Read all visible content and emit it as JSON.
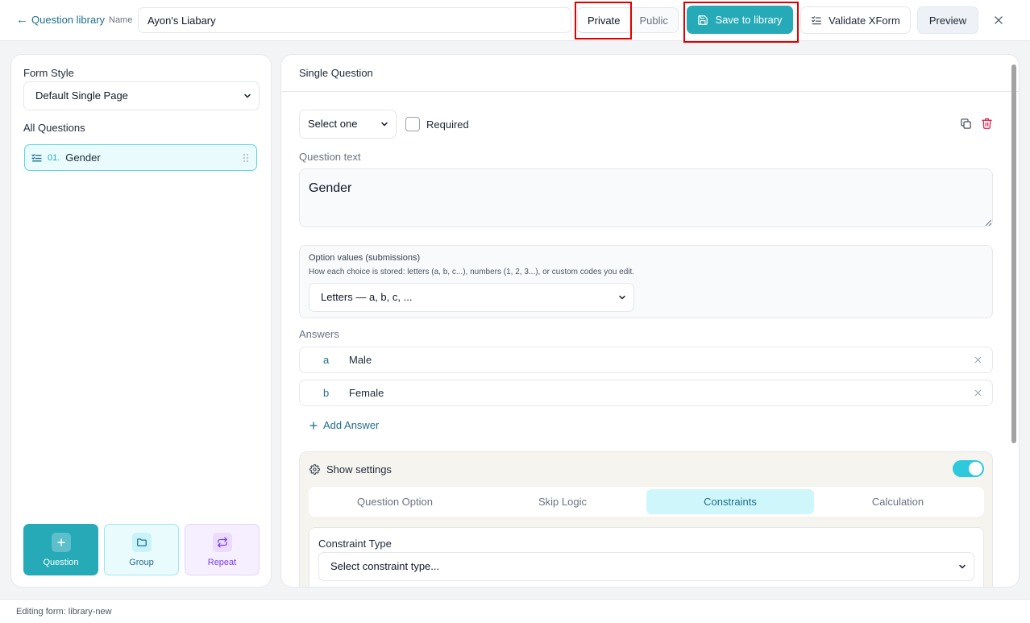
{
  "header": {
    "back_label": "Question library",
    "name_label": "Name",
    "name_value": "Ayon's Liabary",
    "visibility": {
      "private": "Private",
      "public": "Public",
      "selected": "Private"
    },
    "save_label": "Save to library",
    "validate_label": "Validate XForm",
    "preview_label": "Preview"
  },
  "sidebar": {
    "form_style_label": "Form Style",
    "form_style_value": "Default Single Page",
    "all_questions_label": "All Questions",
    "questions": [
      {
        "number": "01.",
        "title": "Gender"
      }
    ],
    "tools": {
      "question": "Question",
      "group": "Group",
      "repeat": "Repeat"
    }
  },
  "editor": {
    "panel_title": "Single Question",
    "type_value": "Select one",
    "required_label": "Required",
    "required_checked": false,
    "question_text_label": "Question text",
    "question_text_value": "Gender",
    "option_values": {
      "title": "Option values (submissions)",
      "description": "How each choice is stored: letters (a, b, c...), numbers (1, 2, 3...), or custom codes you edit.",
      "selected": "Letters — a, b, c, ..."
    },
    "answers_label": "Answers",
    "answers": [
      {
        "key": "a",
        "label": "Male"
      },
      {
        "key": "b",
        "label": "Female"
      }
    ],
    "add_answer_label": "Add Answer",
    "settings": {
      "title": "Show settings",
      "enabled": true,
      "tabs": [
        {
          "label": "Question Option",
          "active": false
        },
        {
          "label": "Skip Logic",
          "active": false
        },
        {
          "label": "Constraints",
          "active": true
        },
        {
          "label": "Calculation",
          "active": false
        }
      ],
      "constraint_type_label": "Constraint Type",
      "constraint_type_placeholder": "Select constraint type..."
    }
  },
  "status": {
    "text": "Editing form: library-new"
  },
  "colors": {
    "accent": "#26aab7",
    "link": "#1f6f8b",
    "danger": "#e11d48",
    "highlight": "#e00000"
  }
}
